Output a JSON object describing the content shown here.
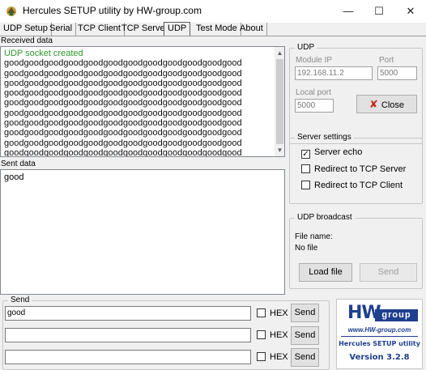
{
  "window": {
    "title": "Hercules SETUP utility by HW-group.com",
    "controls": {
      "minimize": "—",
      "maximize": "☐",
      "close": "✕"
    }
  },
  "tabs": [
    {
      "label": "UDP Setup"
    },
    {
      "label": "Serial"
    },
    {
      "label": "TCP Client"
    },
    {
      "label": "TCP Server"
    },
    {
      "label": "UDP",
      "active": true
    },
    {
      "label": "Test Mode"
    },
    {
      "label": "About"
    }
  ],
  "received": {
    "label": "Received data",
    "lines": [
      "UDP socket created",
      "goodgoodgoodgoodgoodgoodgoodgoodgoodgoodgoodgood",
      "goodgoodgoodgoodgoodgoodgoodgoodgoodgoodgoodgood",
      "goodgoodgoodgoodgoodgoodgoodgoodgoodgoodgoodgood",
      "goodgoodgoodgoodgoodgoodgoodgoodgoodgoodgoodgood",
      "goodgoodgoodgoodgoodgoodgoodgoodgoodgoodgoodgood",
      "goodgoodgoodgoodgoodgoodgoodgoodgoodgoodgoodgood",
      "goodgoodgoodgoodgoodgoodgoodgoodgoodgoodgoodgood",
      "goodgoodgoodgoodgoodgoodgoodgoodgoodgoodgoodgood",
      "goodgoodgoodgoodgoodgoodgoodgoodgoodgoodgoodgood",
      "goodgoodgoodgoodgoodgoodgoodgoodgoodgoodgoodgood"
    ]
  },
  "sent": {
    "label": "Sent data",
    "text": "good"
  },
  "udp": {
    "group_title": "UDP",
    "module_ip_label": "Module IP",
    "module_ip_value": "192.168.11.2",
    "port_label": "Port",
    "port_value": "5000",
    "local_port_label": "Local port",
    "local_port_value": "5000",
    "close_button": "Close"
  },
  "server_settings": {
    "group_title": "Server settings",
    "server_echo": {
      "label": "Server echo",
      "checked": true
    },
    "redirect_udp": {
      "label": "Redirect to TCP Server",
      "checked": false
    },
    "redirect_tcp": {
      "label": "Redirect to TCP Client",
      "checked": false
    }
  },
  "udp_broadcast": {
    "group_title": "UDP broadcast",
    "file_name_label": "File name:",
    "file_name_value": "No file",
    "load_button": "Load file",
    "send_button": "Send"
  },
  "send": {
    "group_title": "Send",
    "rows": [
      {
        "value": "good",
        "hex_label": "HEX",
        "button": "Send"
      },
      {
        "value": "",
        "hex_label": "HEX",
        "button": "Send"
      },
      {
        "value": "",
        "hex_label": "HEX",
        "button": "Send"
      }
    ]
  },
  "logo": {
    "hw": "HW",
    "group": "group",
    "url": "www.HW-group.com",
    "product": "Hercules SETUP utility",
    "version": "Version  3.2.8"
  },
  "colors": {
    "background": "#f0f0f0",
    "status_green": "#2e9a2e",
    "brand_blue": "#1f3f8f",
    "close_red": "#c42b1c"
  }
}
